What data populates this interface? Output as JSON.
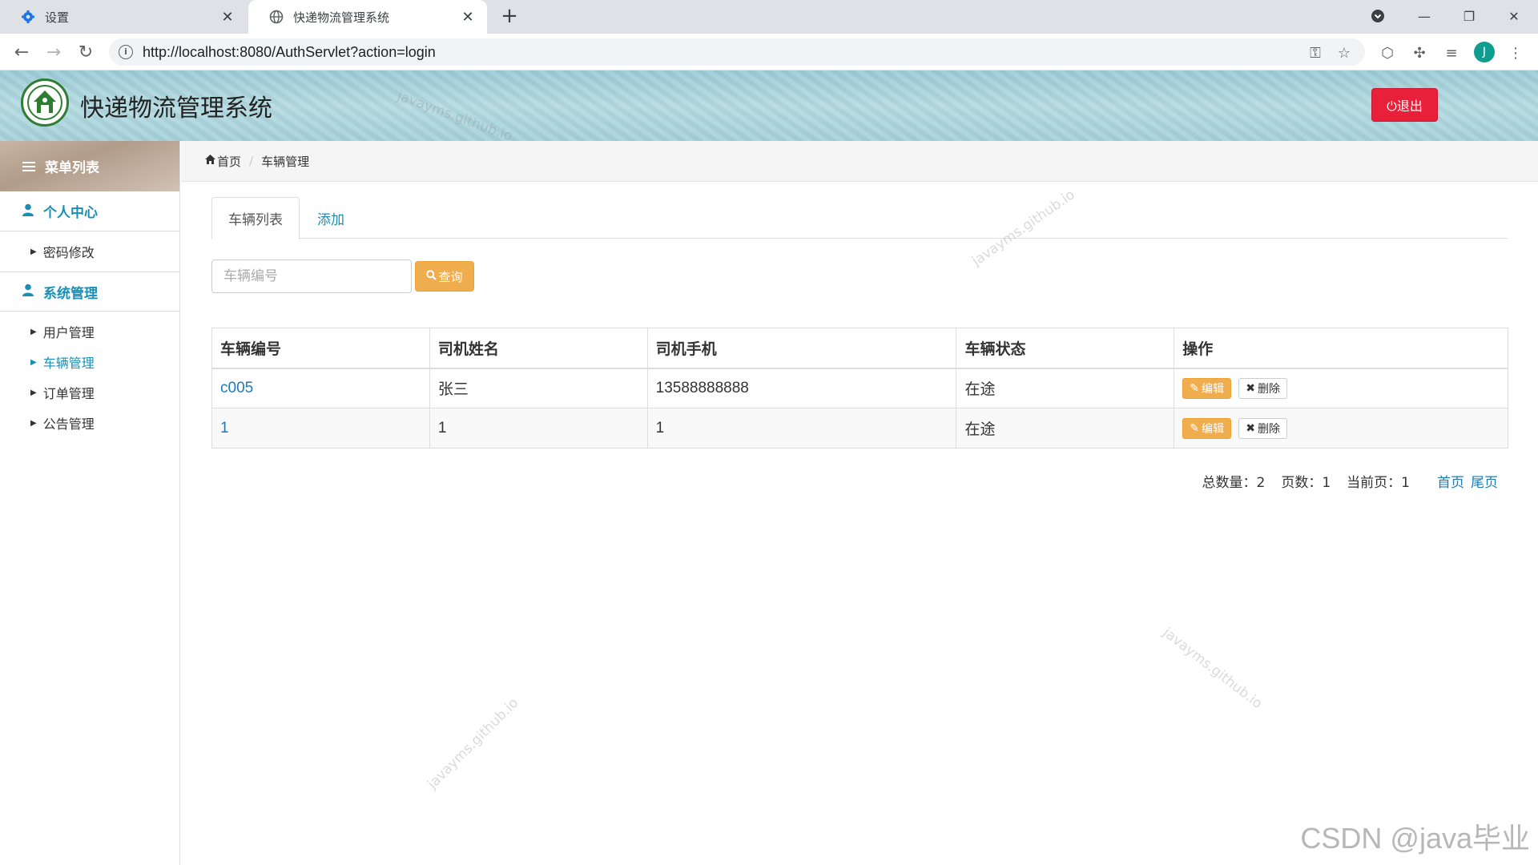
{
  "browser": {
    "tabs": [
      {
        "title": "设置",
        "icon": "gear-icon"
      },
      {
        "title": "快递物流管理系统",
        "icon": "globe-icon"
      }
    ],
    "url": "http://localhost:8080/AuthServlet?action=login",
    "avatar_letter": "J"
  },
  "header": {
    "title": "快递物流管理系统",
    "logout_label": "⏻退出"
  },
  "sidebar": {
    "menu_title": "菜单列表",
    "groups": [
      {
        "label": "个人中心",
        "items": [
          {
            "label": "密码修改"
          }
        ]
      },
      {
        "label": "系统管理",
        "items": [
          {
            "label": "用户管理"
          },
          {
            "label": "车辆管理"
          },
          {
            "label": "订单管理"
          },
          {
            "label": "公告管理"
          }
        ]
      }
    ]
  },
  "breadcrumb": {
    "home": "首页",
    "current": "车辆管理"
  },
  "tabs": {
    "list_label": "车辆列表",
    "add_label": "添加"
  },
  "search": {
    "placeholder": "车辆编号",
    "button_label": "查询"
  },
  "table": {
    "headers": [
      "车辆编号",
      "司机姓名",
      "司机手机",
      "车辆状态",
      "操作"
    ],
    "rows": [
      {
        "id": "c005",
        "driver": "张三",
        "phone": "13588888888",
        "status": "在途",
        "edit": "编辑",
        "delete": "删除"
      },
      {
        "id": "1",
        "driver": "1",
        "phone": "1",
        "status": "在途",
        "edit": "编辑",
        "delete": "删除"
      }
    ]
  },
  "pager": {
    "total": "总数量：2",
    "pages": "页数：1",
    "current": "当前页：1",
    "first": "首页",
    "last": "尾页"
  },
  "watermark": {
    "text": "javayms.github.io",
    "csdn": "CSDN @java毕业"
  },
  "colors": {
    "accent": "#1a8fb3",
    "danger": "#e8203a",
    "warning": "#f0ad4e"
  }
}
